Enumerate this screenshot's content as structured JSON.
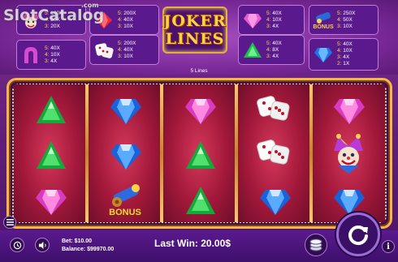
{
  "watermark": {
    "text": "SlotCatalog",
    "suffix": ".com"
  },
  "logo": {
    "line1": "JOKER",
    "line2": "LINES"
  },
  "paytable": [
    {
      "id": "joker",
      "rows": [
        {
          "k": "5:",
          "v": "100X"
        },
        {
          "k": "4:",
          "v": "30X"
        },
        {
          "k": "3:",
          "v": "20X"
        }
      ]
    },
    {
      "id": "horseshoe",
      "rows": [
        {
          "k": "5:",
          "v": "40X"
        },
        {
          "k": "4:",
          "v": "10X"
        },
        {
          "k": "3:",
          "v": "4X"
        }
      ]
    },
    {
      "id": "red-gem",
      "rows": [
        {
          "k": "5:",
          "v": "200X"
        },
        {
          "k": "4:",
          "v": "40X"
        },
        {
          "k": "3:",
          "v": "10X"
        }
      ]
    },
    {
      "id": "dice",
      "rows": [
        {
          "k": "5:",
          "v": "200X"
        },
        {
          "k": "4:",
          "v": "40X"
        },
        {
          "k": "3:",
          "v": "10X"
        }
      ]
    },
    {
      "id": "pink-gem",
      "rows": [
        {
          "k": "5:",
          "v": "40X"
        },
        {
          "k": "4:",
          "v": "10X"
        },
        {
          "k": "3:",
          "v": "4X"
        }
      ]
    },
    {
      "id": "green-gem",
      "rows": [
        {
          "k": "5:",
          "v": "40X"
        },
        {
          "k": "4:",
          "v": "8X"
        },
        {
          "k": "3:",
          "v": "4X"
        }
      ]
    },
    {
      "id": "bonus",
      "rows": [
        {
          "k": "5:",
          "v": "250X"
        },
        {
          "k": "4:",
          "v": "50X"
        },
        {
          "k": "3:",
          "v": "10X"
        }
      ]
    },
    {
      "id": "blue-gem",
      "rows": [
        {
          "k": "5:",
          "v": "40X"
        },
        {
          "k": "4:",
          "v": "10X"
        },
        {
          "k": "3:",
          "v": "4X"
        },
        {
          "k": "2:",
          "v": "1X"
        }
      ]
    }
  ],
  "lines_label": "5 Lines",
  "reels": [
    [
      "green-gem",
      "green-gem",
      "pink-gem"
    ],
    [
      "blue-gem",
      "blue-gem",
      "bonus"
    ],
    [
      "pink-gem",
      "green-gem",
      "green-gem"
    ],
    [
      "dice",
      "dice",
      "blue-gem"
    ],
    [
      "pink-gem",
      "joker",
      "blue-gem"
    ]
  ],
  "bonus_label": "BONUS",
  "bet": {
    "label": "Bet:",
    "value": "$10.00"
  },
  "balance": {
    "label": "Balance:",
    "value": "$99970.00"
  },
  "last_win": {
    "label": "Last Win:",
    "value": "20.00$"
  },
  "colors": {
    "gold": "#ffd24a",
    "frame": "#f0b84a",
    "panel": "#5a1a8e"
  },
  "icons": {
    "menu": "menu-icon",
    "history": "history-icon",
    "sound": "sound-icon",
    "info": "info-icon",
    "coins": "coins-icon",
    "spin": "spin-icon"
  }
}
